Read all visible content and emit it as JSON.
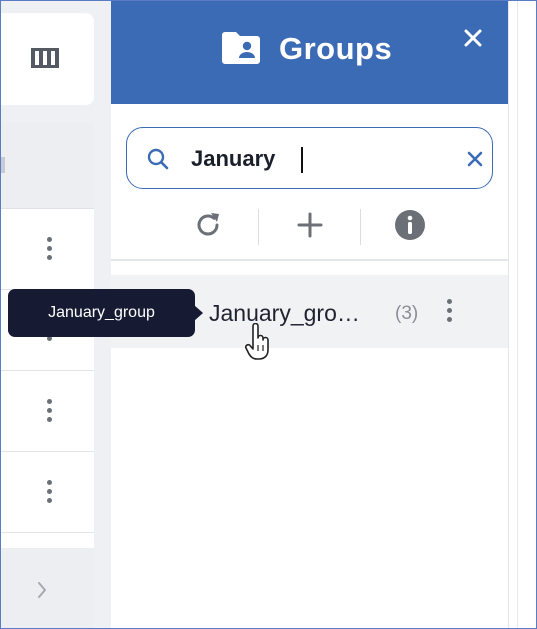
{
  "groups_panel": {
    "title": "Groups",
    "title_icon": "folder-user-icon",
    "close_icon": "close-icon",
    "search": {
      "value": "January",
      "placeholder": "",
      "search_icon": "search-icon",
      "clear_icon": "clear-icon"
    },
    "toolbar": {
      "refresh_icon": "refresh-icon",
      "add_icon": "plus-icon",
      "info_icon": "info-icon"
    },
    "groups": [
      {
        "name": "January_gro…",
        "count": "(3)",
        "menu_icon": "kebab-icon"
      }
    ]
  },
  "tooltip": {
    "text": "January_group"
  },
  "left_panel": {
    "columns_icon": "columns-icon",
    "row_menu_icon": "kebab-icon",
    "chevron_icon": "chevron-right-icon"
  },
  "colors": {
    "header_blue": "#3b6bb5",
    "tooltip_bg": "#161b33",
    "row_hover": "#f1f2f4",
    "icon_gray": "#6b6f76"
  }
}
